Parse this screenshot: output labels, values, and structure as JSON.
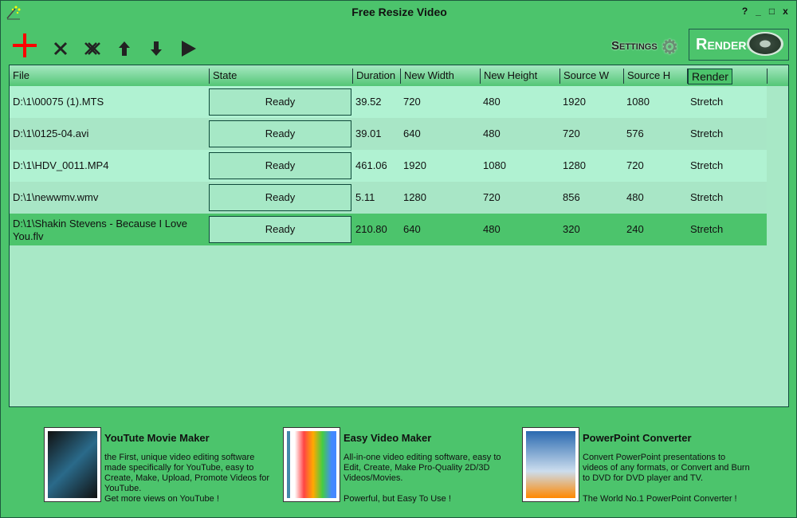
{
  "window": {
    "title": "Free Resize Video",
    "buttons": [
      "?",
      "_",
      "□",
      "x"
    ]
  },
  "toolbar": {
    "tools": [
      {
        "name": "add-icon"
      },
      {
        "name": "remove-icon"
      },
      {
        "name": "remove-all-icon"
      },
      {
        "name": "move-up-icon"
      },
      {
        "name": "move-down-icon"
      },
      {
        "name": "play-icon"
      }
    ],
    "settings_label": "Settings",
    "render_label": "Render"
  },
  "accent": "#4cc46c",
  "table": {
    "headers": [
      "File",
      "State",
      "Duration",
      "New Width",
      "New Height",
      "Source W",
      "Source H",
      ""
    ],
    "tooltip": "Render",
    "rows": [
      {
        "file": "D:\\1\\00075 (1).MTS",
        "state": "Ready",
        "duration": "39.52",
        "new_width": "720",
        "new_height": "480",
        "source_w": "1920",
        "source_h": "1080",
        "fill": "Stretch"
      },
      {
        "file": "D:\\1\\0125-04.avi",
        "state": "Ready",
        "duration": "39.01",
        "new_width": "640",
        "new_height": "480",
        "source_w": "720",
        "source_h": "576",
        "fill": "Stretch"
      },
      {
        "file": "D:\\1\\HDV_0011.MP4",
        "state": "Ready",
        "duration": "461.06",
        "new_width": "1920",
        "new_height": "1080",
        "source_w": "1280",
        "source_h": "720",
        "fill": "Stretch"
      },
      {
        "file": "D:\\1\\newwmv.wmv",
        "state": "Ready",
        "duration": "5.11",
        "new_width": "1280",
        "new_height": "720",
        "source_w": "856",
        "source_h": "480",
        "fill": "Stretch"
      },
      {
        "file": "D:\\1\\Shakin Stevens - Because I Love You.flv",
        "state": "Ready",
        "duration": "210.80",
        "new_width": "640",
        "new_height": "480",
        "source_w": "320",
        "source_h": "240",
        "fill": "Stretch",
        "selected": true
      }
    ]
  },
  "ads": [
    {
      "title": "YouTute Movie Maker",
      "text": "the First, unique video editing software made specifically for YouTube, easy to Create, Make, Upload, Promote Videos for YouTube.\nGet more views on YouTube !"
    },
    {
      "title": "Easy Video Maker",
      "text": "All-in-one video editing software, easy to Edit, Create, Make Pro-Quality 2D/3D Videos/Movies.\n\nPowerful, but Easy To Use !"
    },
    {
      "title": "PowerPoint Converter",
      "text": "Convert PowerPoint presentations to videos of any formats, or Convert and Burn to DVD for DVD player and TV.\n\nThe World No.1 PowerPoint Converter !"
    }
  ]
}
